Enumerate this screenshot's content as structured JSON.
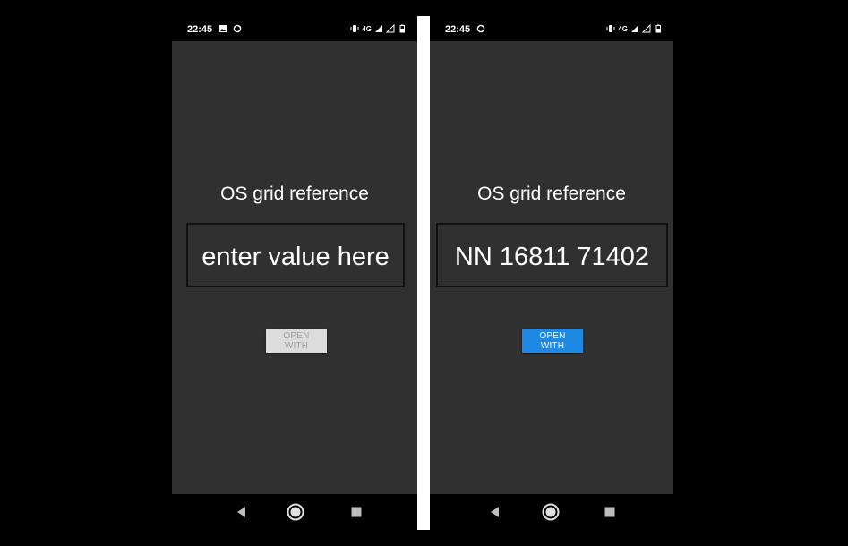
{
  "left_screen": {
    "status_time": "22:45",
    "network": "4G",
    "label": "OS grid reference",
    "input_placeholder": "enter value here",
    "button_label": "OPEN WITH",
    "button_enabled": false
  },
  "right_screen": {
    "status_time": "22:45",
    "network": "4G",
    "label": "OS grid reference",
    "input_value": "NN 16811 71402",
    "button_label": "OPEN WITH",
    "button_enabled": true
  },
  "colors": {
    "app_background": "#303030",
    "button_active": "#1e88e5",
    "button_disabled": "#dcdcdc"
  },
  "icons": [
    "image-icon",
    "sync-icon",
    "vibrate-icon",
    "signal-icon",
    "battery-icon",
    "back-icon",
    "home-icon",
    "recents-icon"
  ]
}
